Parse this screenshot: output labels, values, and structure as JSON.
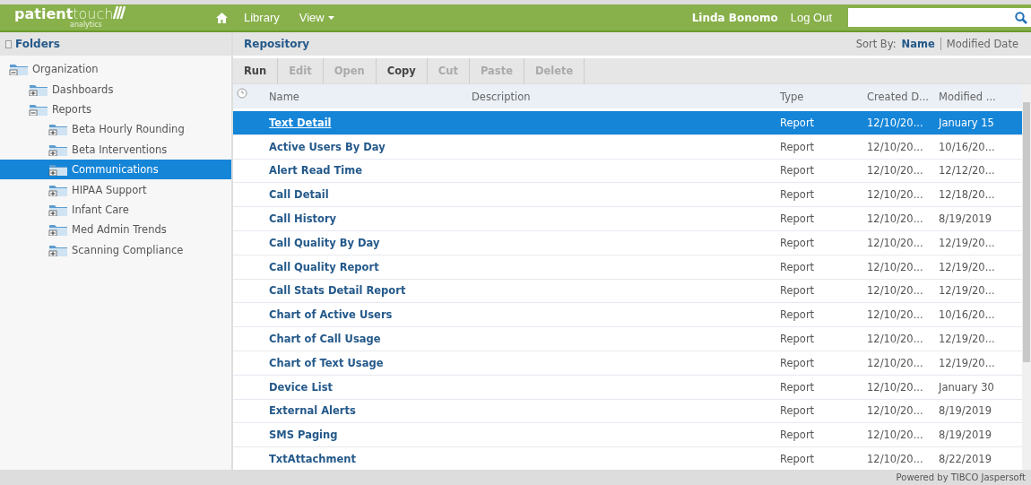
{
  "header": {
    "logo": {
      "bold": "patient",
      "light": "touch",
      "tagline": "analytics"
    },
    "nav": [
      {
        "label": "Library",
        "dropdown": false
      },
      {
        "label": "View",
        "dropdown": true
      }
    ],
    "user": "Linda Bonomo",
    "logout": "Log Out"
  },
  "folders": {
    "title": "Folders",
    "tree": [
      {
        "label": "Organization",
        "expanded": true,
        "selected": false,
        "children": [
          {
            "label": "Dashboards",
            "expanded": false,
            "selected": false
          },
          {
            "label": "Reports",
            "expanded": true,
            "selected": false,
            "children": [
              {
                "label": "Beta Hourly Rounding",
                "expanded": false,
                "selected": false
              },
              {
                "label": "Beta Interventions",
                "expanded": false,
                "selected": false
              },
              {
                "label": "Communications",
                "expanded": false,
                "selected": true
              },
              {
                "label": "HIPAA Support",
                "expanded": false,
                "selected": false
              },
              {
                "label": "Infant Care",
                "expanded": false,
                "selected": false
              },
              {
                "label": "Med Admin Trends",
                "expanded": false,
                "selected": false
              },
              {
                "label": "Scanning Compliance",
                "expanded": false,
                "selected": false
              }
            ]
          }
        ]
      }
    ]
  },
  "repository": {
    "title": "Repository",
    "sort_label": "Sort By:",
    "sort_options": [
      {
        "label": "Name",
        "selected": true
      },
      {
        "label": "Modified Date",
        "selected": false
      }
    ],
    "toolbar": [
      {
        "label": "Run",
        "disabled": false
      },
      {
        "label": "Edit",
        "disabled": true
      },
      {
        "label": "Open",
        "disabled": true
      },
      {
        "label": "Copy",
        "disabled": false
      },
      {
        "label": "Cut",
        "disabled": true
      },
      {
        "label": "Paste",
        "disabled": true
      },
      {
        "label": "Delete",
        "disabled": true
      }
    ],
    "columns": [
      "Name",
      "Description",
      "Type",
      "Created D...",
      "Modified ..."
    ],
    "rows": [
      {
        "name": "Text Detail",
        "type": "Report",
        "created": "12/10/20...",
        "modified": "January 15",
        "selected": true
      },
      {
        "name": "Active Users By Day",
        "type": "Report",
        "created": "12/10/20...",
        "modified": "10/16/20...",
        "selected": false
      },
      {
        "name": "Alert Read Time",
        "type": "Report",
        "created": "12/10/20...",
        "modified": "12/12/20...",
        "selected": false
      },
      {
        "name": "Call Detail",
        "type": "Report",
        "created": "12/10/20...",
        "modified": "12/18/20...",
        "selected": false
      },
      {
        "name": "Call History",
        "type": "Report",
        "created": "12/10/20...",
        "modified": "8/19/2019",
        "selected": false
      },
      {
        "name": "Call Quality By Day",
        "type": "Report",
        "created": "12/10/20...",
        "modified": "12/19/20...",
        "selected": false
      },
      {
        "name": "Call Quality Report",
        "type": "Report",
        "created": "12/10/20...",
        "modified": "12/19/20...",
        "selected": false
      },
      {
        "name": "Call Stats Detail Report",
        "type": "Report",
        "created": "12/10/20...",
        "modified": "12/19/20...",
        "selected": false
      },
      {
        "name": "Chart of Active Users",
        "type": "Report",
        "created": "12/10/20...",
        "modified": "10/16/20...",
        "selected": false
      },
      {
        "name": "Chart of Call Usage",
        "type": "Report",
        "created": "12/10/20...",
        "modified": "12/19/20...",
        "selected": false
      },
      {
        "name": "Chart of Text Usage",
        "type": "Report",
        "created": "12/10/20...",
        "modified": "12/19/20...",
        "selected": false
      },
      {
        "name": "Device List",
        "type": "Report",
        "created": "12/10/20...",
        "modified": "January 30",
        "selected": false
      },
      {
        "name": "External Alerts",
        "type": "Report",
        "created": "12/10/20...",
        "modified": "8/19/2019",
        "selected": false
      },
      {
        "name": "SMS Paging",
        "type": "Report",
        "created": "12/10/20...",
        "modified": "8/19/2019",
        "selected": false
      },
      {
        "name": "TxtAttachment",
        "type": "Report",
        "created": "12/10/20...",
        "modified": "8/22/2019",
        "selected": false
      }
    ]
  },
  "footer": "Powered by TIBCO Jaspersoft"
}
